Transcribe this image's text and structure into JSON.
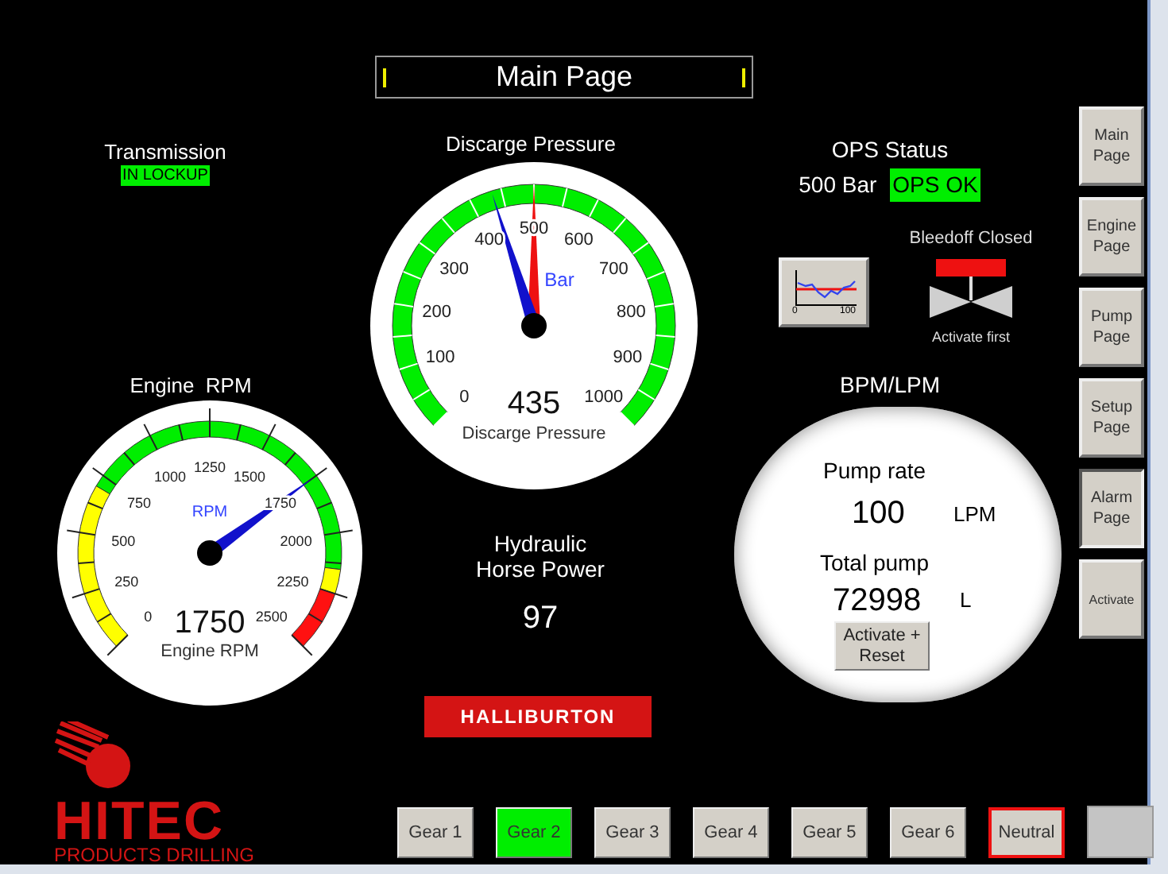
{
  "title": "Main Page",
  "transmission": {
    "label": "Transmission",
    "status": "IN LOCKUP"
  },
  "discharge_gauge": {
    "title": "Discarge Pressure",
    "unit": "Bar",
    "scale": [
      "0",
      "100",
      "200",
      "300",
      "400",
      "500",
      "600",
      "700",
      "800",
      "900",
      "1000"
    ],
    "level": 0.435,
    "setpoint": {
      "level": 0.5
    },
    "reading": "435",
    "caption": "Discarge Pressure"
  },
  "rpm_gauge": {
    "title": "Engine  RPM",
    "unit": "RPM",
    "scale": [
      "0",
      "250",
      "500",
      "750",
      "1000",
      "1250",
      "1500",
      "1750",
      "2000",
      "2250",
      "2500"
    ],
    "level": 0.7,
    "reading": "1750",
    "caption": "Engine RPM"
  },
  "hydraulic": {
    "label": "Hydraulic Horse Power",
    "value": "97"
  },
  "brand_logo": "HALLIBURTON",
  "ops": {
    "label": "OPS Status",
    "pressure": "500 Bar",
    "status": "OPS OK"
  },
  "trend_button": {
    "axis_labels": [
      "0",
      "100"
    ]
  },
  "bleedoff": {
    "status": "Bleedoff Closed",
    "hint": "Activate first"
  },
  "pump": {
    "title": "BPM/LPM",
    "rate_label": "Pump rate",
    "rate": "100",
    "rate_unit": "LPM",
    "total_label": "Total pump",
    "total": "72998",
    "total_unit": "L",
    "button": "Activate + Reset"
  },
  "nav_buttons": [
    {
      "label": "Main Page",
      "selected": false
    },
    {
      "label": "Engine Page",
      "selected": false
    },
    {
      "label": "Pump Page",
      "selected": false
    },
    {
      "label": "Setup Page",
      "selected": false
    },
    {
      "label": "Alarm Page",
      "selected": true
    },
    {
      "label": "Activate",
      "selected": false
    }
  ],
  "gear_buttons": [
    {
      "kind": "gear",
      "label": "Gear 1",
      "selected": false,
      "outlined": false
    },
    {
      "kind": "gear",
      "label": "Gear 2",
      "selected": true,
      "outlined": false
    },
    {
      "kind": "gear",
      "label": "Gear 3",
      "selected": false,
      "outlined": false
    },
    {
      "kind": "gear",
      "label": "Gear 4",
      "selected": false,
      "outlined": false
    },
    {
      "kind": "gear",
      "label": "Gear 5",
      "selected": false,
      "outlined": false
    },
    {
      "kind": "gear",
      "label": "Gear 6",
      "selected": false,
      "outlined": false
    },
    {
      "kind": "gear",
      "label": "Neutral",
      "selected": false,
      "outlined": true
    },
    {
      "kind": "blank",
      "selected": false,
      "outlined": false
    }
  ],
  "company_logo": {
    "name": "HITEC",
    "tagline": "PRODUCTS DRILLING"
  }
}
